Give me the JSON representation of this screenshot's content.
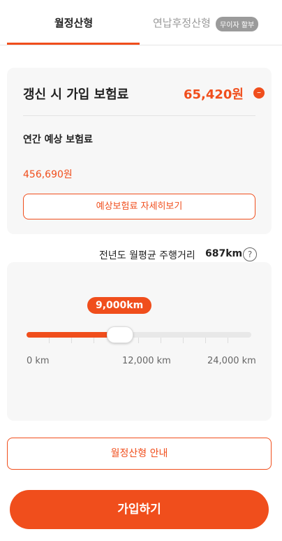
{
  "tabs": [
    {
      "label": "월정산형"
    },
    {
      "label": "연납후정산형"
    }
  ],
  "badge": "무이자 할부",
  "insurance": {
    "title": "갱신 시 가입 보험료",
    "amount": "65,420원",
    "annual_label": "연간 예상 보험료",
    "annual_value": "456,690원",
    "detail_button": "예상보험료 자세히보기"
  },
  "average": {
    "label": "전년도 월평균 주행거리",
    "value": "687km"
  },
  "slider": {
    "bubble": "9,000km",
    "value_km": 9000,
    "min_km": 0,
    "max_km": 24000,
    "labels": [
      "0 km",
      "12,000 km",
      "24,000 km"
    ]
  },
  "guide_button": "월정산형 안내",
  "join_button": "가입하기",
  "colors": {
    "accent": "#f04e1c"
  }
}
